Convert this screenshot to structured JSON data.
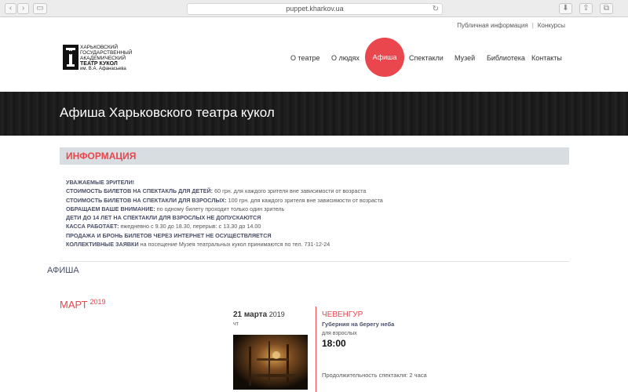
{
  "browser": {
    "url": "puppet.kharkov.ua"
  },
  "top_links": {
    "public_info": "Публичная информация",
    "separator": "|",
    "contests": "Конкурсы"
  },
  "logo": {
    "line1": "Харьковский",
    "line2": "государственный",
    "line3": "академический",
    "line4": "театр кукол",
    "line5": "им. В.А. Афанасьева"
  },
  "nav": {
    "items": [
      "О театре",
      "О людях",
      "Афиша",
      "Спектакли",
      "Музей",
      "Библиотека",
      "Контакты"
    ],
    "active": "Афиша",
    "accent_color": "#e9464e"
  },
  "hero": {
    "title": "Афиша Харьковского театра кукол"
  },
  "info": {
    "heading": "ИНФОРМАЦИЯ",
    "lines": [
      {
        "bold": "УВАЖАЕМЫЕ ЗРИТЕЛИ!",
        "text": ""
      },
      {
        "bold": "СТОИМОСТЬ БИЛЕТОВ НА СПЕКТАКЛЬ ДЛЯ ДЕТЕЙ:",
        "text": " 60 грн. для каждого зрителя вне зависимости от возраста"
      },
      {
        "bold": "СТОИМОСТЬ БИЛЕТОВ НА СПЕКТАКЛИ ДЛЯ ВЗРОСЛЫХ:",
        "text": " 100 грн. для каждого зрителя вне зависимости от возраста"
      },
      {
        "bold": "ОБРАЩАЕМ ВАШЕ ВНИМАНИЕ:",
        "text": " по одному билету проходит только один зритель"
      },
      {
        "bold": "ДЕТИ ДО 14 ЛЕТ НА СПЕКТАКЛИ ДЛЯ ВЗРОСЛЫХ НЕ ДОПУСКАЮТСЯ",
        "text": ""
      },
      {
        "bold": "КАССА РАБОТАЕТ:",
        "text": " ежедневно с 9.30 до 18.30, перерыв: с 13.30 до 14.00"
      },
      {
        "bold": "ПРОДАЖА И БРОНЬ БИЛЕТОВ ЧЕРЕЗ ИНТЕРНЕТ НЕ ОСУЩЕСТВЛЯЕТСЯ",
        "text": ""
      },
      {
        "bold": "КОЛЛЕКТИВНЫЕ ЗАЯВКИ",
        "text": " на посещение Музея театральных кукол принимаются по тел. 731-12-24"
      }
    ]
  },
  "afisha": {
    "label": "АФИША",
    "month": "МАРТ",
    "year": "2019",
    "event": {
      "day": "21 марта",
      "year": "2019",
      "weekday": "чт",
      "title": "ЧЕВЕНГУР",
      "subtitle": "Губерния на берегу неба",
      "audience": "для взрослых",
      "time": "18:00",
      "duration": "Продолжительность спектакля: 2 часа"
    }
  }
}
